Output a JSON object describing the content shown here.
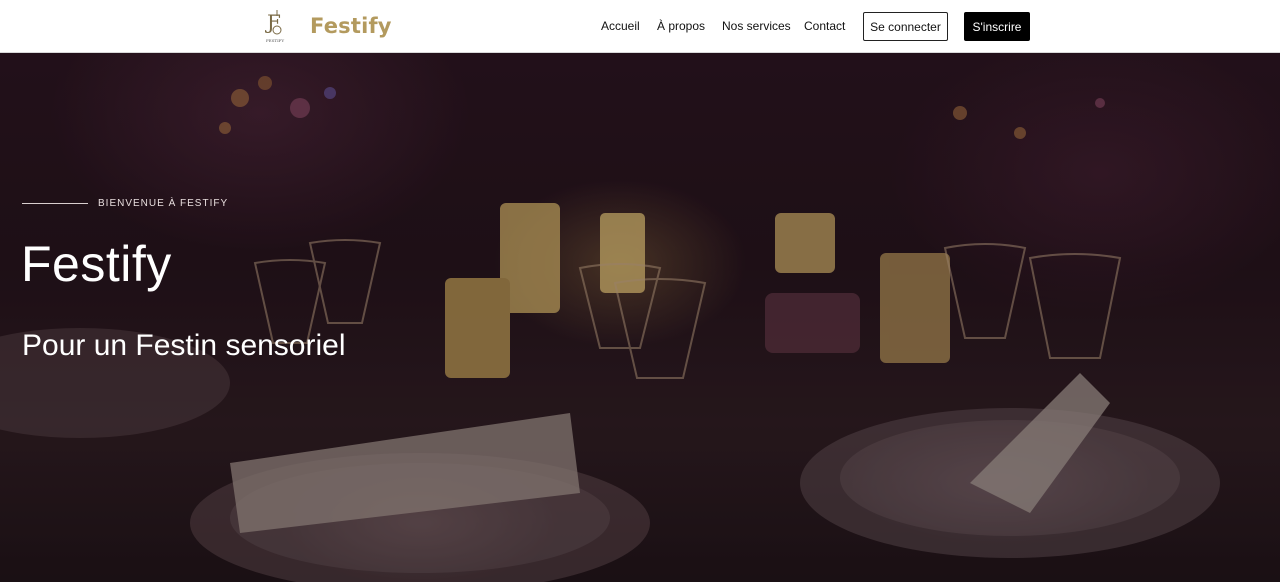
{
  "header": {
    "logo_text": "FESTIFY",
    "brand": "Festify",
    "nav": [
      "Accueil",
      "À propos",
      "Nos services",
      "Contact"
    ],
    "login_label": "Se connecter",
    "signup_label": "S'inscrire"
  },
  "hero": {
    "eyebrow": "BIENVENUE À FESTIFY",
    "title": "Festify",
    "subtitle": "Pour un Festin sensoriel"
  },
  "colors": {
    "brand_gold": "#b39a5e",
    "header_bg": "#ffffff",
    "signup_bg": "#000000"
  }
}
